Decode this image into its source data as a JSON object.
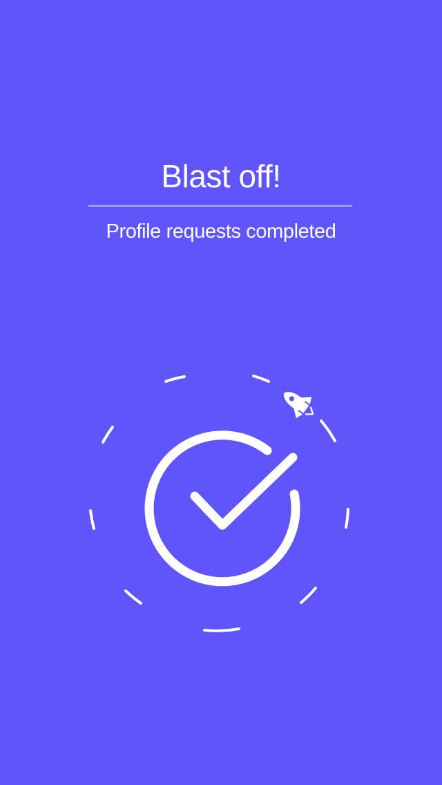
{
  "screen": {
    "title": "Blast off!",
    "subtitle": "Profile requests completed",
    "background_color": "#5F55FB",
    "foreground_color": "#FFFFFF"
  },
  "graphic": {
    "center_icon": "check-circle-icon",
    "orbit_icon": "dashed-orbit-ring",
    "accent_icon": "rocket-icon"
  }
}
